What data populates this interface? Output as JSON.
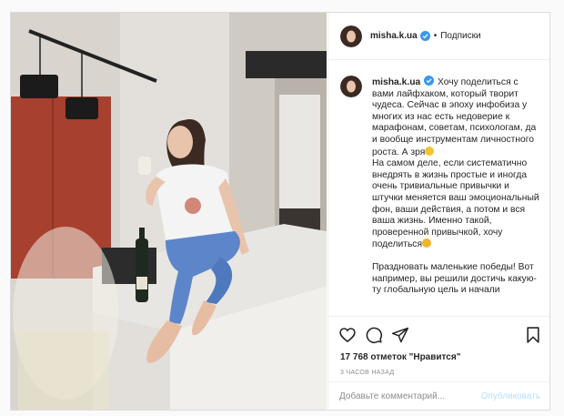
{
  "post": {
    "username": "misha.k.ua",
    "follow_label": "Подписки",
    "caption_paragraphs": [
      "Хочу поделиться с вами лайфхаком, который творит чудеса. Сейчас в эпоху инфобиза у многих из нас есть недоверие к марафонам, советам, психологам, да и вообще инструментам личностного роста. А зря",
      "На самом деле, если систематично внедрять в жизнь простые и иногда очень тривиальные привычки и штучки меняется ваш эмоциональный фон, ваши действия, а потом и вся ваша жизнь. Именно такой, проверенной привычкой, хочу поделиться",
      "Праздновать маленькие победы! Вот например, вы решили достичь какую-ту глобальную цель и начали"
    ],
    "likes_text": "17 768 отметок \"Нравится\"",
    "time_text": "3 ЧАСОВ НАЗАД",
    "comment_placeholder": "Добавьте комментарий...",
    "publish_label": "Опубликовать"
  },
  "icons": {
    "verified": "verified-badge-icon",
    "like": "heart-icon",
    "comment": "comment-icon",
    "share": "paper-plane-icon",
    "save": "bookmark-icon",
    "emoji_1": "grimacing-face-emoji",
    "emoji_2": "scream-face-emoji"
  },
  "colors": {
    "verified": "#3897f0",
    "publish": "#b2dffc",
    "meta_text": "#8e8e8e",
    "border": "#dbdbdb"
  }
}
